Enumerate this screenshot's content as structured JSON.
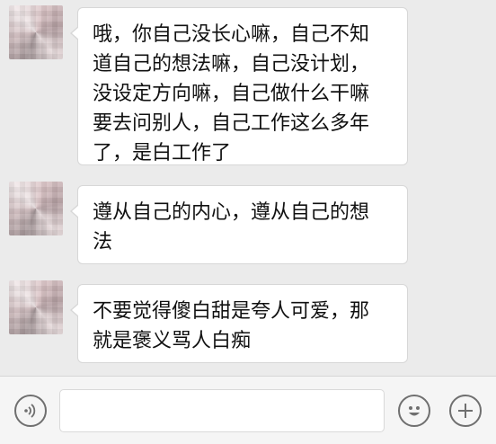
{
  "messages": [
    {
      "text": "哦，你自己没长心嘛，自己不知\n道自己的想法嘛，自己没计划，\n没设定方向嘛，自己做什么干嘛\n要去问别人，自己工作这么多年\n了，是白工作了"
    },
    {
      "text": "遵从自己的内心，遵从自己的想\n法"
    },
    {
      "text": "不要觉得傻白甜是夸人可爱，那\n就是褒义骂人白痴"
    }
  ],
  "input_bar": {
    "left_icon": "voice-icon",
    "emoji_icon": "emoji-icon",
    "add_icon": "plus-icon",
    "text_value": ""
  }
}
